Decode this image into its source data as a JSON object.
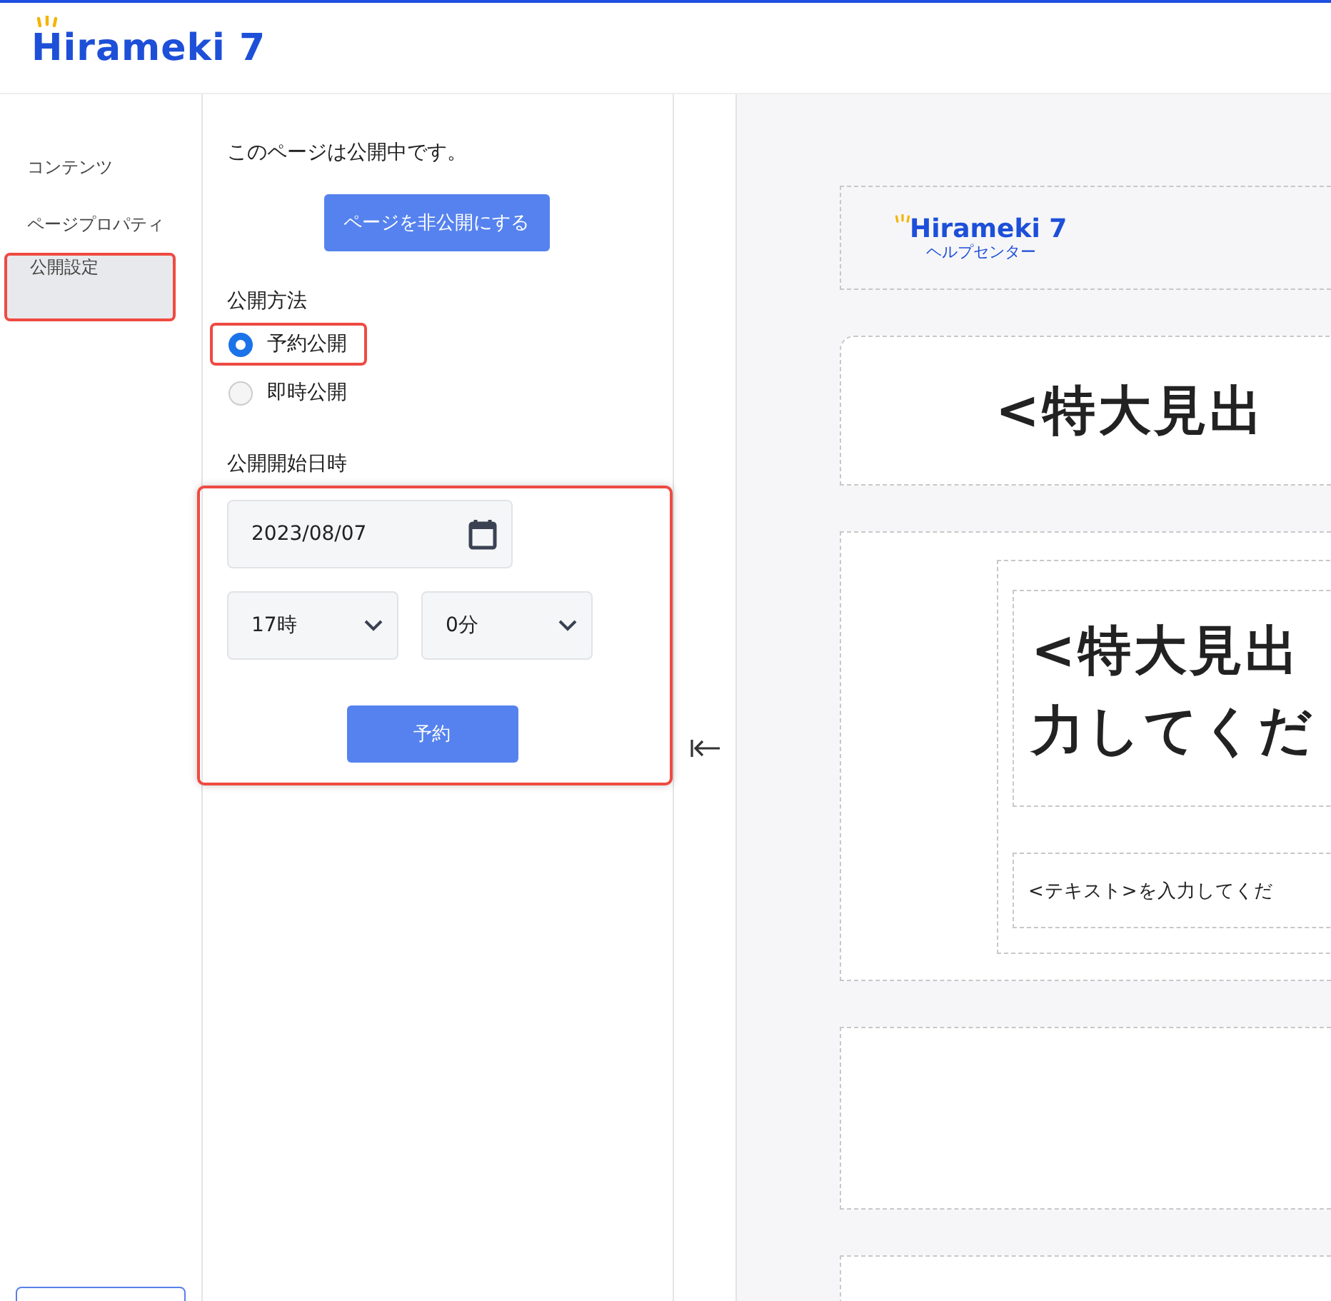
{
  "header": {
    "logo": "Hirameki 7"
  },
  "sidebar": {
    "items": [
      {
        "label": "コンテンツ",
        "selected": false,
        "highlighted": false
      },
      {
        "label": "ページプロパティ",
        "selected": false,
        "highlighted": false
      },
      {
        "label": "公開設定",
        "selected": true,
        "highlighted": true
      }
    ]
  },
  "panel": {
    "status": "このページは公開中です。",
    "unpublish_button": "ページを非公開にする",
    "method_label": "公開方法",
    "methods": [
      {
        "label": "予約公開",
        "selected": true,
        "highlighted": true
      },
      {
        "label": "即時公開",
        "selected": false,
        "highlighted": false
      }
    ],
    "start_label": "公開開始日時",
    "schedule": {
      "highlighted": true,
      "date": "2023/08/07",
      "hour": "17時",
      "minute": "0分",
      "submit": "予約"
    }
  },
  "preview": {
    "logo": "Hirameki 7",
    "logo_subtitle": "ヘルプセンター",
    "heading": "<特大見出",
    "heading_lines": [
      "<特大見出",
      "力してくだ"
    ],
    "text": "<テキスト>を入力してくだ"
  }
}
